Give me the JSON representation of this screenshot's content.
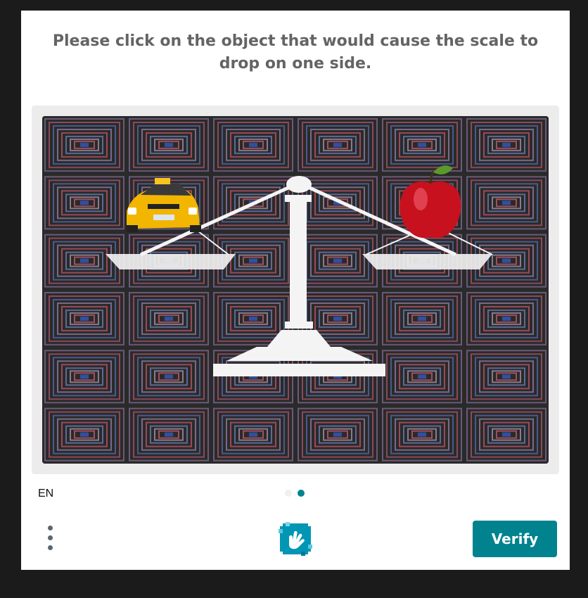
{
  "challenge": {
    "prompt": "Please click on the object that would cause the scale to drop on one side.",
    "image": {
      "objects": [
        "taxi",
        "apple",
        "balance-scale"
      ]
    }
  },
  "footer": {
    "language": "EN",
    "pages": {
      "count": 2,
      "current": 2
    },
    "menu_icon": "three-dot-menu-icon",
    "logo_icon": "hand-logo-icon",
    "verify_label": "Verify"
  },
  "colors": {
    "accent": "#00838f",
    "prompt_text": "#646464",
    "background": "#1b1b1b"
  }
}
